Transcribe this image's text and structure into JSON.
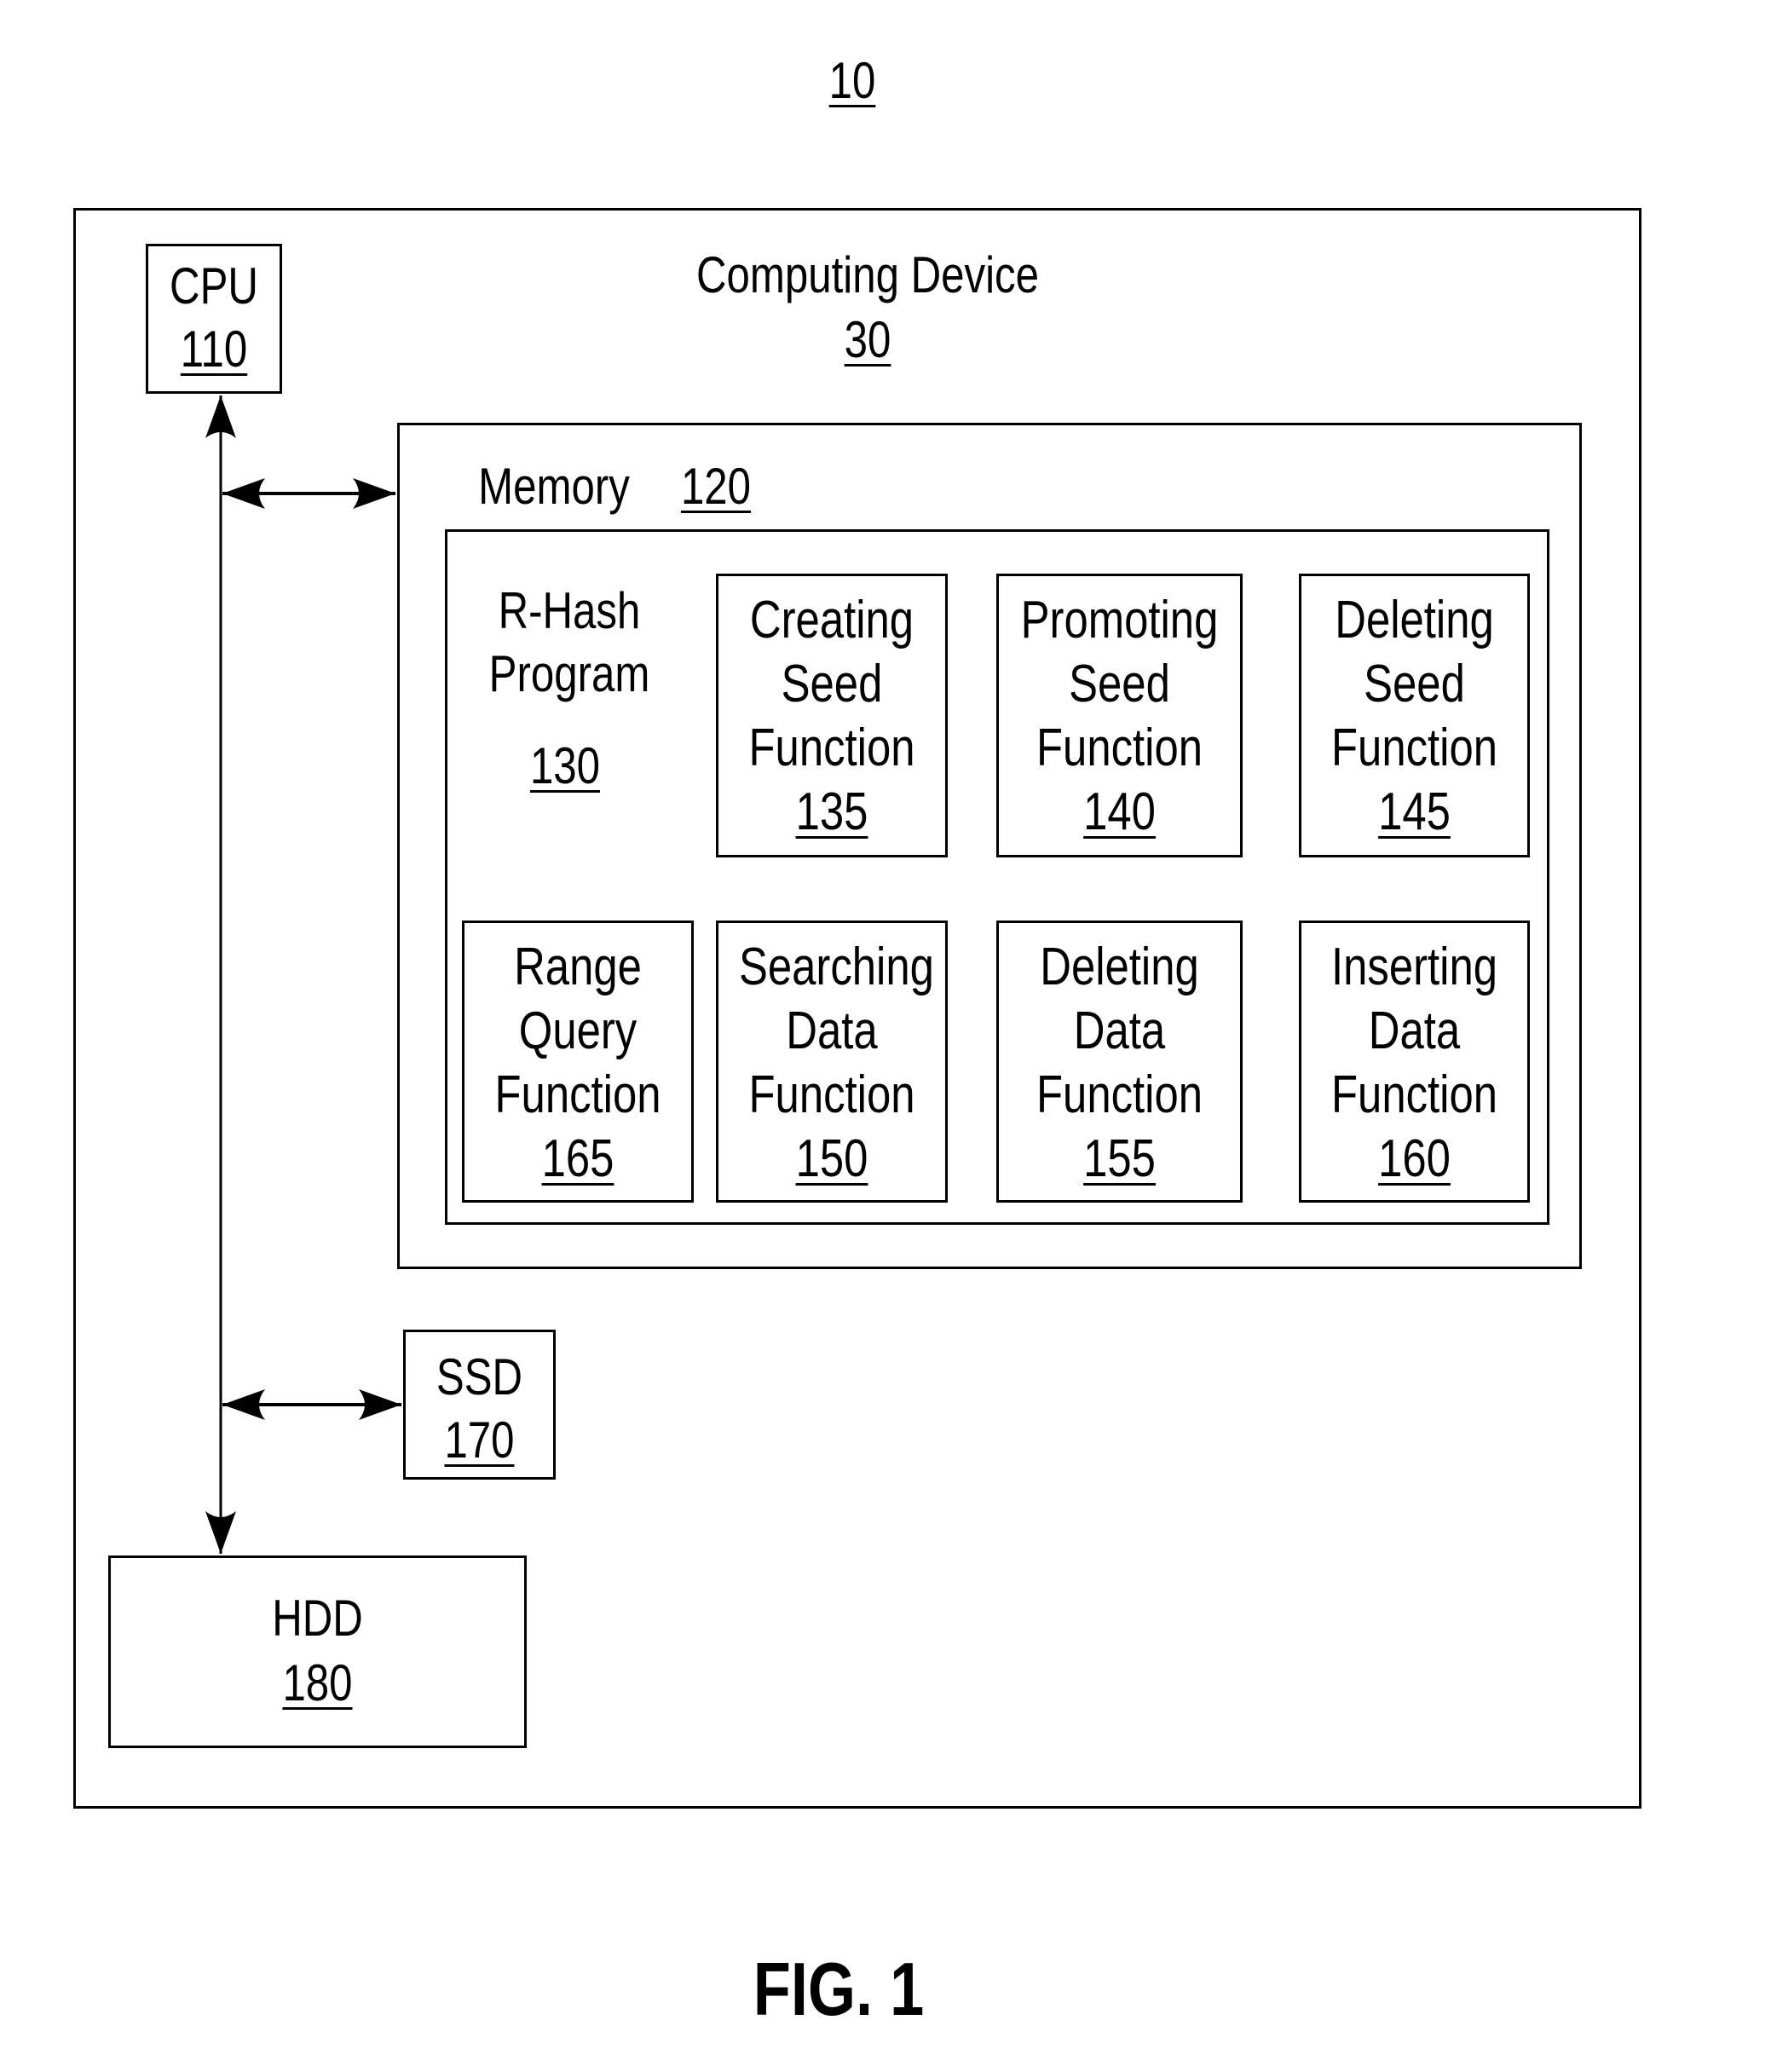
{
  "figure": {
    "ref_number": "10",
    "caption": "FIG. 1"
  },
  "computing_device": {
    "title": "Computing Device",
    "ref": "30"
  },
  "cpu": {
    "title": "CPU",
    "ref": "110"
  },
  "memory": {
    "title": "Memory",
    "ref": "120"
  },
  "rhash_program": {
    "line1": "R-Hash",
    "line2": "Program",
    "ref": "130"
  },
  "functions": [
    {
      "lines": [
        "Creating",
        "Seed",
        "Function"
      ],
      "ref": "135"
    },
    {
      "lines": [
        "Promoting",
        "Seed",
        "Function"
      ],
      "ref": "140"
    },
    {
      "lines": [
        "Deleting",
        "Seed",
        "Function"
      ],
      "ref": "145"
    },
    {
      "lines": [
        "Range",
        "Query",
        "Function"
      ],
      "ref": "165"
    },
    {
      "lines": [
        "Searching",
        "Data",
        "Function"
      ],
      "ref": "150"
    },
    {
      "lines": [
        "Deleting",
        "Data",
        "Function"
      ],
      "ref": "155"
    },
    {
      "lines": [
        "Inserting",
        "Data",
        "Function"
      ],
      "ref": "160"
    }
  ],
  "ssd": {
    "title": "SSD",
    "ref": "170"
  },
  "hdd": {
    "title": "HDD",
    "ref": "180"
  }
}
